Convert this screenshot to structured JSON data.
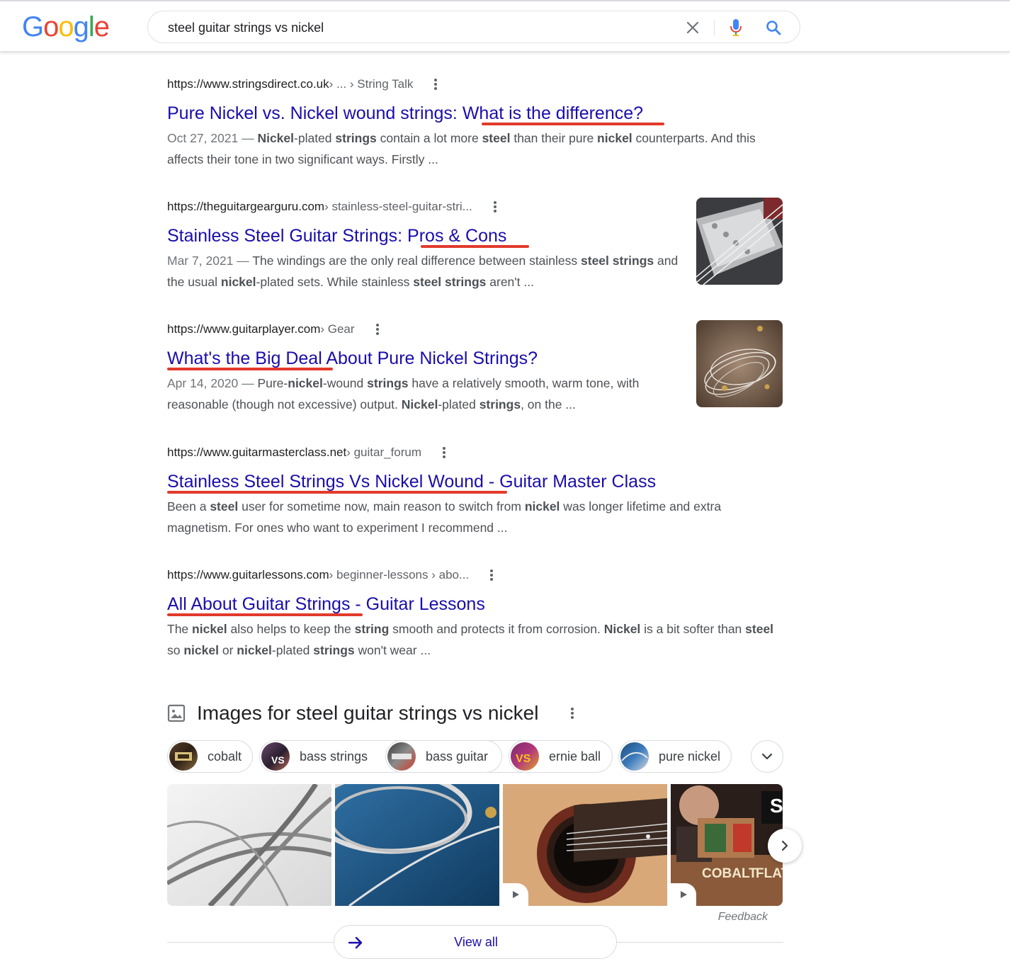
{
  "header": {
    "logo_letters": [
      {
        "ch": "G",
        "color": "#4285F4"
      },
      {
        "ch": "o",
        "color": "#EA4335"
      },
      {
        "ch": "o",
        "color": "#FBBC05"
      },
      {
        "ch": "g",
        "color": "#4285F4"
      },
      {
        "ch": "l",
        "color": "#34A853"
      },
      {
        "ch": "e",
        "color": "#EA4335"
      }
    ],
    "search_query": "steel guitar strings vs nickel"
  },
  "results": [
    {
      "domain": "https://www.stringsdirect.co.uk",
      "path": " › ... › String Talk",
      "title_a": "Pure Nickel vs. Nickel wound strings: ",
      "title_b": "What is the difference?",
      "date": "Oct 27, 2021",
      "snippet_html": "<b>Nickel</b>-plated <b>strings</b> contain a lot more <b>steel</b> than their pure <b>nickel</b> counterparts. And this affects their tone in two significant ways. Firstly ..."
    },
    {
      "domain": "https://theguitargearguru.com",
      "path": " › stainless-steel-guitar-stri...",
      "title_a": "Stainless Steel Guitar Strings: ",
      "title_b": "Pros & Cons",
      "date": "Mar 7, 2021",
      "snippet_html": "The windings are the only real difference between stainless <b>steel strings</b> and the usual <b>nickel</b>-plated sets. While stainless <b>steel strings</b> aren't ..."
    },
    {
      "domain": "https://www.guitarplayer.com",
      "path": " › Gear",
      "title_a": "What's the Big Deal",
      "title_b": " About Pure Nickel Strings?",
      "date": "Apr 14, 2020",
      "snippet_html": "Pure-<b>nickel</b>-wound <b>strings</b> have a relatively smooth, warm tone, with reasonable (though not excessive) output. <b>Nickel</b>-plated <b>strings</b>, on the ..."
    },
    {
      "domain": "https://www.guitarmasterclass.net",
      "path": " › guitar_forum",
      "title_a": "Stainless Steel Strings Vs Nickel Wound",
      "title_b": " - Guitar Master Class",
      "date": "",
      "snippet_html": "Been a <b>steel</b> user for sometime now, main reason to switch from <b>nickel</b> was longer lifetime and extra magnetism. For ones who want to experiment I recommend ..."
    },
    {
      "domain": "https://www.guitarlessons.com",
      "path": " › beginner-lessons › abo...",
      "title_a": "All About Guitar Strings",
      "title_b": " - Guitar Lessons",
      "date": "",
      "snippet_html": "The <b>nickel</b> also helps to keep the <b>string</b> smooth and protects it from corrosion. <b>Nickel</b> is a bit softer than <b>steel</b> so <b>nickel</b> or <b>nickel</b>-plated <b>strings</b> won't wear ..."
    }
  ],
  "images_section": {
    "heading": "Images for steel guitar strings vs nickel",
    "chips": [
      "cobalt",
      "bass strings",
      "bass guitar",
      "ernie ball",
      "pure nickel"
    ],
    "thumb_badge_vs": "VS",
    "tile_text_1": "S",
    "tile_text_2": "COBALT",
    "tile_text_3": "FLAT",
    "feedback": "Feedback",
    "view_all": "View all"
  },
  "colors": {
    "link": "#1a0dab",
    "underline_annotation": "#e23a2c",
    "snippet": "#4d5156"
  }
}
